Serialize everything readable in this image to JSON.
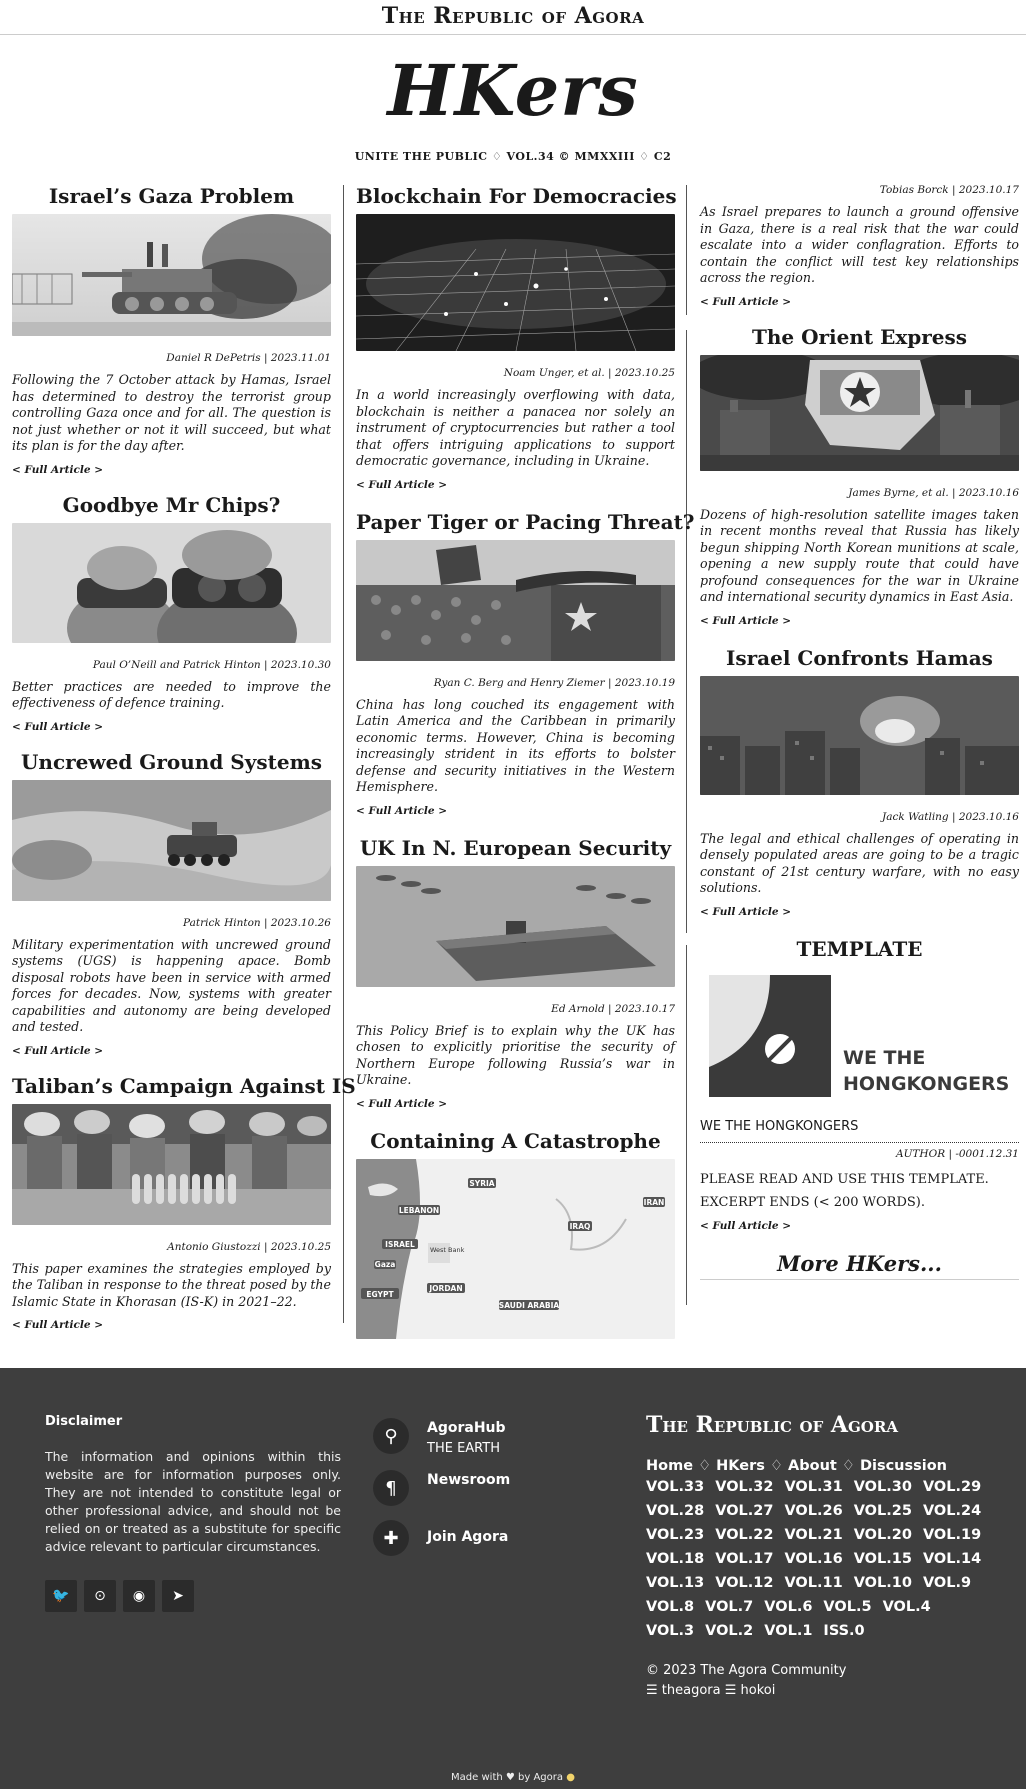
{
  "site_title": "The Republic of Agora",
  "masthead": "HKers",
  "edition": "UNITE THE PUBLIC ♢ VOL.34 © MMXXIII ♢ C2",
  "columns": [
    [
      {
        "title": "Israel’s Gaza Problem",
        "byline": "Daniel R DePetris | 2023.11.01",
        "excerpt": "Following the 7 October attack by Hamas, Israel has determined to destroy the terrorist group controlling Gaza once and for all. The question is not just whether or not it will succeed, but what its plan is for the day after.",
        "image": "tank"
      },
      {
        "title": "Goodbye Mr Chips?",
        "byline": "Paul O’Neill and Patrick Hinton | 2023.10.30",
        "excerpt": "Better practices are needed to improve the effectiveness of defence training.",
        "image": "vr"
      },
      {
        "title": "Uncrewed Ground Systems",
        "byline": "Patrick Hinton | 2023.10.26",
        "excerpt": "Military experimentation with uncrewed ground systems (UGS) is happening apace. Bomb disposal robots have been in service with armed forces for decades. Now, systems with greater capabilities and autonomy are being developed and tested.",
        "image": "ugv"
      },
      {
        "title": "Taliban’s Campaign Against IS",
        "byline": "Antonio Giustozzi | 2023.10.25",
        "excerpt": "This paper examines the strategies employed by the Taliban in response to the threat posed by the Islamic State in Khorasan (IS-K) in 2021–22.",
        "image": "taliban"
      }
    ],
    [
      {
        "title": "Blockchain For Democracies",
        "byline": "Noam Unger, et al. | 2023.10.25",
        "excerpt": "In a world increasingly overflowing with data, blockchain is neither a panacea nor solely an instrument of cryptocurrencies but rather a tool that offers intriguing applications to support democratic governance, including in Ukraine.",
        "image": "grid"
      },
      {
        "title": "Paper Tiger or Pacing Threat?",
        "byline": "Ryan C. Berg and Henry Ziemer | 2023.10.19",
        "excerpt": "China has long couched its engagement with Latin America and the Caribbean in primarily economic terms. However, China is becoming increasingly strident in its efforts to bolster defense and security initiatives in the Western Hemisphere.",
        "image": "china"
      },
      {
        "title": "UK In N. European Security",
        "byline": "Ed Arnold | 2023.10.17",
        "excerpt": "This Policy Brief is to explain why the UK has chosen to explicitly prioritise the security of Northern Europe following Russia’s war in Ukraine.",
        "image": "ships"
      },
      {
        "title": "Containing A Catastrophe",
        "image": "map",
        "map_labels": [
          "SYRIA",
          "LEBANON",
          "IRAN",
          "IRAQ",
          "ISRAEL",
          "West Bank",
          "Gaza",
          "JORDAN",
          "EGYPT",
          "SAUDI ARABIA"
        ]
      }
    ],
    [
      {
        "byline": "Tobias Borck | 2023.10.17",
        "excerpt": "As Israel prepares to launch a ground offensive in Gaza, there is a real risk that the war could escalate into a wider conflagration. Efforts to contain the conflict will test key relationships across the region."
      },
      {
        "title": "The Orient Express",
        "byline": "James Byrne, et al. | 2023.10.16",
        "excerpt": "Dozens of high-resolution satellite images taken in recent months reveal that Russia has likely begun shipping North Korean munitions at scale, opening a new supply route that could have profound consequences for the war in Ukraine and international security dynamics in East Asia.",
        "image": "korea"
      },
      {
        "title": "Israel Confronts Hamas",
        "byline": "Jack Watling | 2023.10.16",
        "excerpt": "The legal and ethical challenges of operating in densely populated areas are going to be a tragic constant of 21st century warfare, with no easy solutions.",
        "image": "explosion"
      }
    ]
  ],
  "full_article_label": "< Full Article >",
  "template_card": {
    "title": "TEMPLATE",
    "logo_text": [
      "WE THE",
      "HONGKONGERS"
    ],
    "caption": "WE THE HONGKONGERS",
    "author": "AUTHOR | -0001.12.31",
    "text": "PLEASE READ AND USE THIS TEMPLATE. EXCERPT ENDS (< 200 WORDS)."
  },
  "more": "More HKers...",
  "footer": {
    "disclaimer_heading": "Disclaimer",
    "disclaimer_text": "The information and opinions within this website are for information purposes only. They are not intended to constitute legal or other professional advice, and should not be relied on or treated as a substitute for specific advice relevant to particular circumstances.",
    "social_icons": [
      "twitter-icon",
      "github-icon",
      "reddit-icon",
      "telegram-icon"
    ],
    "links": [
      {
        "label": "AgoraHub",
        "sub": "THE EARTH",
        "icon": "location-pin-icon"
      },
      {
        "label": "Newsroom",
        "icon": "pilcrow-icon"
      },
      {
        "label": "Join Agora",
        "icon": "puzzle-icon"
      }
    ],
    "brand": "The Republic of Agora",
    "nav": [
      "Home",
      "HKers",
      "About",
      "Discussion"
    ],
    "volumes": [
      "VOL.33",
      "VOL.32",
      "VOL.31",
      "VOL.30",
      "VOL.29",
      "VOL.28",
      "VOL.27",
      "VOL.26",
      "VOL.25",
      "VOL.24",
      "VOL.23",
      "VOL.22",
      "VOL.21",
      "VOL.20",
      "VOL.19",
      "VOL.18",
      "VOL.17",
      "VOL.16",
      "VOL.15",
      "VOL.14",
      "VOL.13",
      "VOL.12",
      "VOL.11",
      "VOL.10",
      "VOL.9",
      "VOL.8",
      "VOL.7",
      "VOL.6",
      "VOL.5",
      "VOL.4",
      "VOL.3",
      "VOL.2",
      "VOL.1",
      "ISS.0"
    ],
    "copyright": "© 2023 The Agora Community",
    "handles": "☰ theagora ☰ hokoi",
    "made_with": "Made with ♥ by Agora"
  }
}
